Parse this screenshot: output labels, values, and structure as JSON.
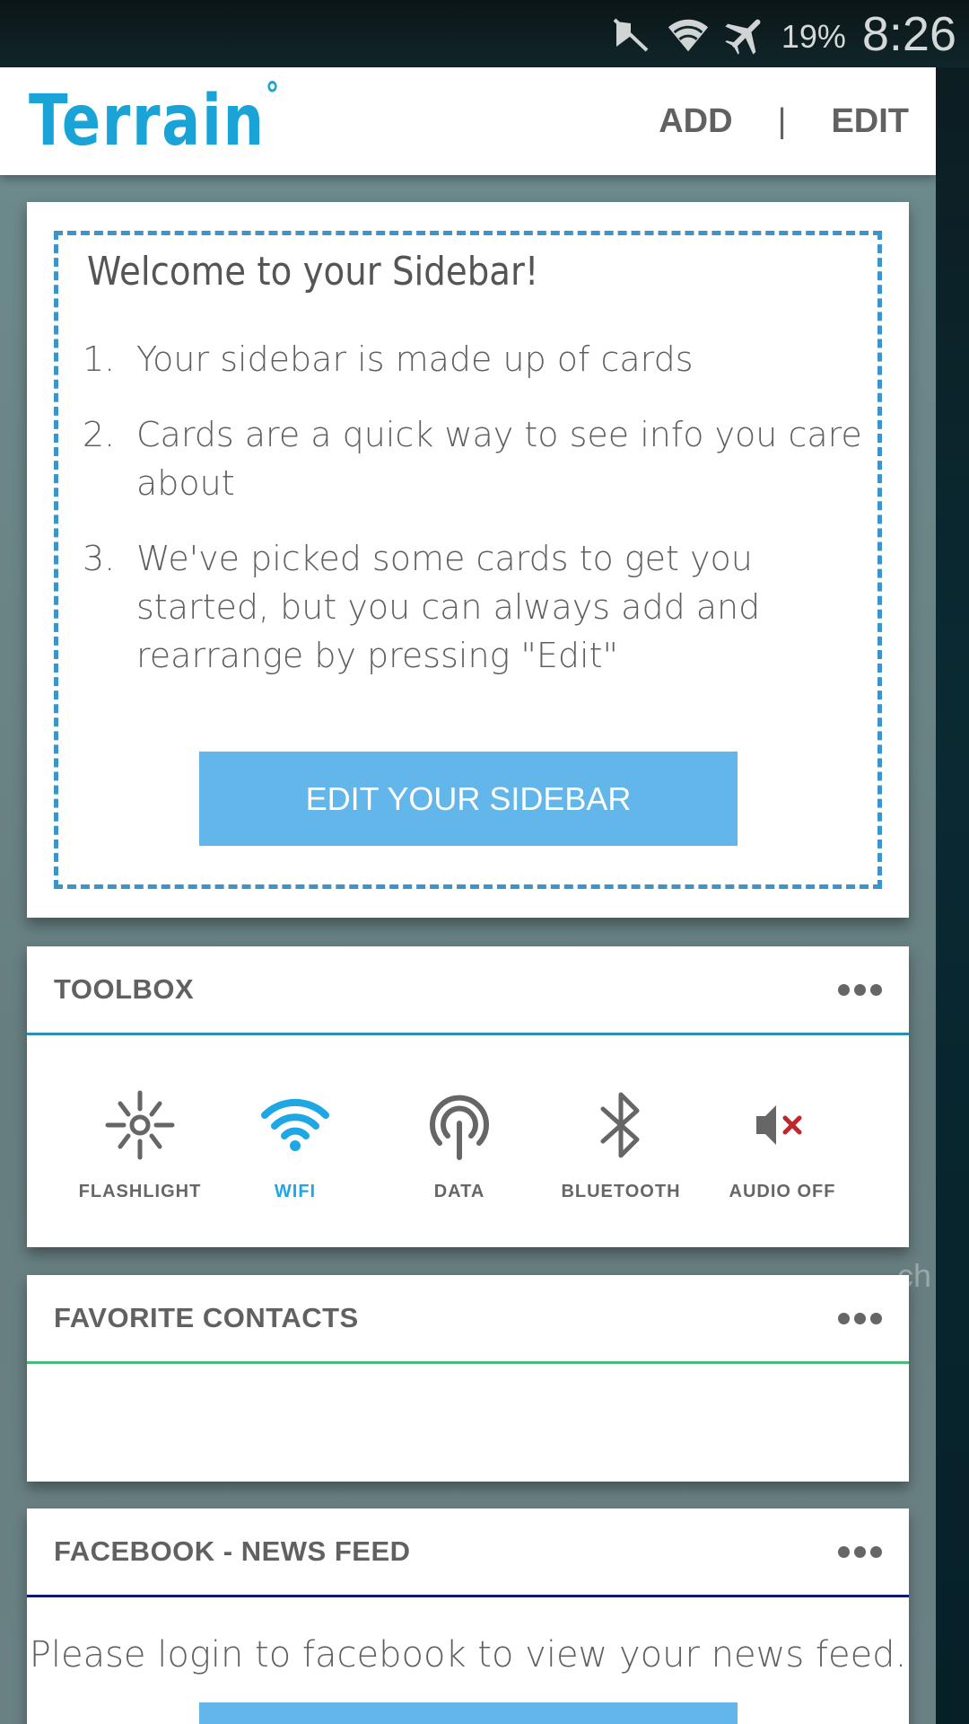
{
  "status_bar": {
    "icons": [
      "mute-icon",
      "wifi-icon",
      "airplane-mode-icon"
    ],
    "battery": "19%",
    "time": "8:26"
  },
  "app_bar": {
    "logo": "Terrain",
    "logo_mark": "°",
    "add_label": "ADD",
    "separator": "|",
    "edit_label": "EDIT"
  },
  "welcome_card": {
    "title": "Welcome to your Sidebar!",
    "items": [
      {
        "num": "1.",
        "text": "Your sidebar is made up of cards"
      },
      {
        "num": "2.",
        "text": "Cards are a quick way to see info you care about"
      },
      {
        "num": "3.",
        "text": "We've picked some cards to get you started, but you can always add and rearrange by pressing \"Edit\""
      }
    ],
    "button_label": "EDIT YOUR SIDEBAR",
    "border_color": "#3d94c8",
    "button_color": "#63b6ea"
  },
  "toolbox_card": {
    "title": "TOOLBOX",
    "accent": "#2a8fb0",
    "tools": [
      {
        "label": "FLASHLIGHT",
        "icon": "flashlight-icon",
        "active": false
      },
      {
        "label": "WIFI",
        "icon": "wifi-icon",
        "active": true
      },
      {
        "label": "DATA",
        "icon": "data-icon",
        "active": false
      },
      {
        "label": "BLUETOOTH",
        "icon": "bluetooth-icon",
        "active": false
      },
      {
        "label": "AUDIO OFF",
        "icon": "audio-off-icon",
        "active": false
      }
    ],
    "active_color": "#1ea7e4",
    "inactive_color": "#666666"
  },
  "contacts_card": {
    "title": "FAVORITE CONTACTS",
    "accent": "#4cbb7a"
  },
  "facebook_card": {
    "title": "FACEBOOK - NEWS FEED",
    "accent": "#0d1a6e",
    "message": "Please login to facebook to view your news feed."
  },
  "background_text": "ch"
}
